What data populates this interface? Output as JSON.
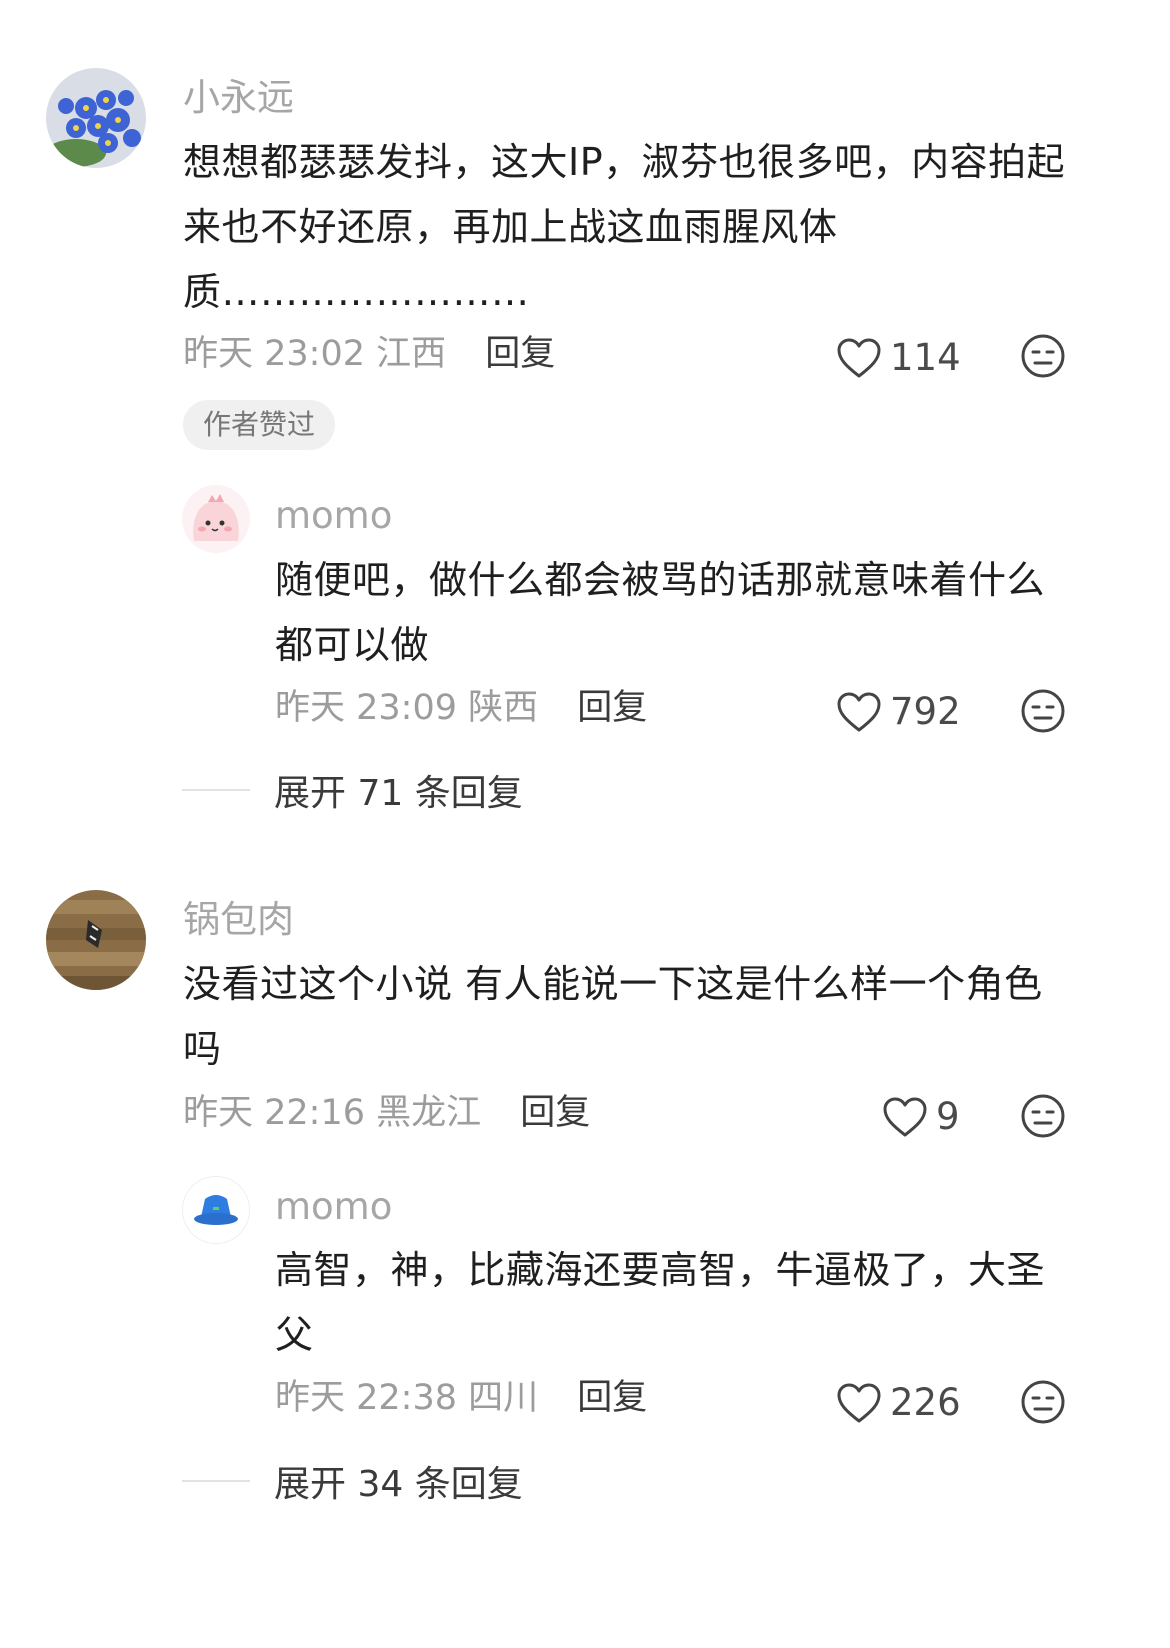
{
  "comments": [
    {
      "username": "小永远",
      "avatar": "forget-me-not-flowers",
      "content": "想想都瑟瑟发抖，这大IP，淑芬也很多吧，内容拍起来也不好还原，再加上战这血雨腥风体质……………………",
      "time": "昨天 23:02",
      "location": "江西",
      "reply_label": "回复",
      "likes": "114",
      "badge": "作者赞过",
      "replies": [
        {
          "username": "momo",
          "avatar": "pink-cartoon-dino",
          "content": "随便吧，做什么都会被骂的话那就意味着什么都可以做",
          "time": "昨天 23:09",
          "location": "陕西",
          "reply_label": "回复",
          "likes": "792"
        }
      ],
      "expand_label": "展开 71 条回复"
    },
    {
      "username": "锅包肉",
      "avatar": "butterfly-on-wood",
      "content": "没看过这个小说 有人能说一下这是什么样一个角色吗",
      "time": "昨天 22:16",
      "location": "黑龙江",
      "reply_label": "回复",
      "likes": "9",
      "replies": [
        {
          "username": "momo",
          "avatar": "blue-bucket-hat",
          "content": "高智，神，比藏海还要高智，牛逼极了，大圣父",
          "time": "昨天 22:38",
          "location": "四川",
          "reply_label": "回复",
          "likes": "226"
        }
      ],
      "expand_label": "展开 34 条回复"
    }
  ],
  "colors": {
    "username": "#a6a6a6",
    "content": "#1f1f1f",
    "meta": "#9c9c9c",
    "badge_bg": "#f0f0f0"
  }
}
